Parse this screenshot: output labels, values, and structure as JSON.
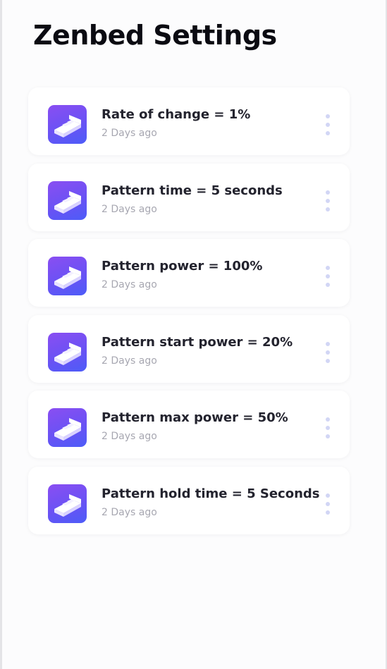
{
  "header": {
    "title": "Zenbed Settings"
  },
  "settings": [
    {
      "title": "Rate of change = 1%",
      "time": "2 Days ago",
      "icon": "bed-icon"
    },
    {
      "title": "Pattern time = 5 seconds",
      "time": "2 Days ago",
      "icon": "bed-icon"
    },
    {
      "title": "Pattern power = 100%",
      "time": "2 Days ago",
      "icon": "bed-icon"
    },
    {
      "title": "Pattern start power = 20%",
      "time": "2 Days ago",
      "icon": "bed-icon"
    },
    {
      "title": "Pattern max power = 50%",
      "time": "2 Days ago",
      "icon": "bed-icon"
    },
    {
      "title": "Pattern hold time = 5 Seconds",
      "time": "2 Days ago",
      "icon": "bed-icon"
    }
  ],
  "colors": {
    "icon_gradient_start": "#8a4ef2",
    "icon_gradient_end": "#4d5cf8",
    "title_text": "#23232e",
    "subtitle_text": "#a7a7b1",
    "menu_dots": "#d2d6f5"
  }
}
